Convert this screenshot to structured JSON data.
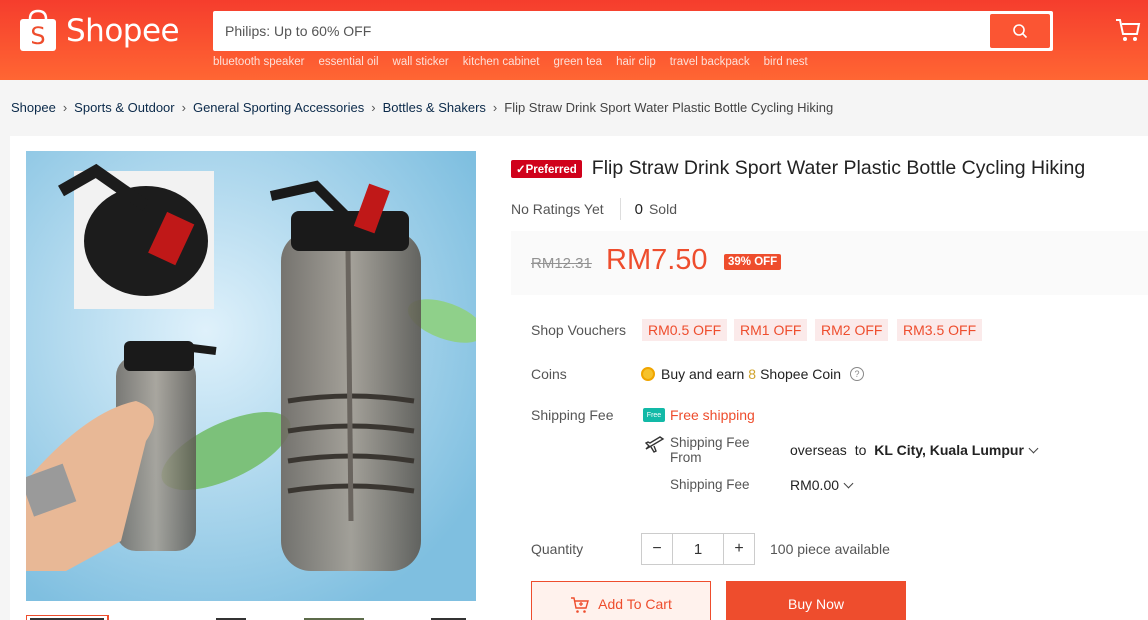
{
  "header": {
    "brand": "Shopee",
    "search_placeholder": "Philips: Up to 60% OFF",
    "hints": [
      "bluetooth speaker",
      "essential oil",
      "wall sticker",
      "kitchen cabinet",
      "green tea",
      "hair clip",
      "travel backpack",
      "bird nest"
    ],
    "colors": {
      "brand": "#ee4d2d"
    }
  },
  "breadcrumb": [
    "Shopee",
    "Sports & Outdoor",
    "General Sporting Accessories",
    "Bottles & Shakers",
    "Flip Straw Drink Sport Water Plastic Bottle Cycling Hiking"
  ],
  "product": {
    "badge": "Preferred",
    "title": "Flip Straw Drink Sport Water Plastic Bottle Cycling Hiking",
    "ratings": "No Ratings Yet",
    "sold_count": "0",
    "sold_label": "Sold",
    "old_price": "RM12.31",
    "price": "RM7.50",
    "discount": "39% OFF"
  },
  "details": {
    "vouchers_label": "Shop Vouchers",
    "vouchers": [
      "RM0.5 OFF",
      "RM1 OFF",
      "RM2 OFF",
      "RM3.5 OFF"
    ],
    "coins_label": "Coins",
    "coins_pre": "Buy and earn ",
    "coins_num": "8",
    "coins_post": " Shopee Coin",
    "shipping_label": "Shipping Fee",
    "free_tag": "Free",
    "free_shipping": "Free shipping",
    "shipping_from_label": "Shipping Fee\nFrom",
    "overseas": "overseas",
    "to": "to",
    "destination": "KL City, Kuala Lumpur",
    "shipping_fee_label": "Shipping Fee",
    "shipping_fee_value": "RM0.00",
    "quantity_label": "Quantity",
    "quantity": "1",
    "minus": "−",
    "plus": "+",
    "available": "100 piece available"
  },
  "actions": {
    "add_to_cart": "Add To Cart",
    "buy_now": "Buy Now"
  }
}
